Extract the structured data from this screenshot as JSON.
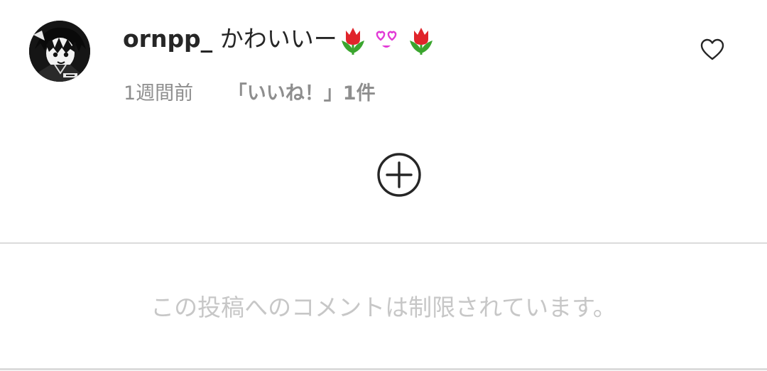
{
  "comment": {
    "username": "ornpp_",
    "text": "かわいいー",
    "emojis": [
      "tulip-icon",
      "heart-eyes-icon",
      "tulip-icon"
    ],
    "time_ago": "1週間前",
    "likes_label": "「いいね！」1件"
  },
  "restricted_message": "この投稿へのコメントは制限されています。",
  "colors": {
    "text_primary": "#262626",
    "text_secondary": "#8e8e8e",
    "text_muted": "#c7c7c7",
    "divider": "#dbdbdb",
    "tulip_red": "#e0242b",
    "tulip_green": "#3aa52e",
    "heart_magenta": "#e23ad6"
  }
}
